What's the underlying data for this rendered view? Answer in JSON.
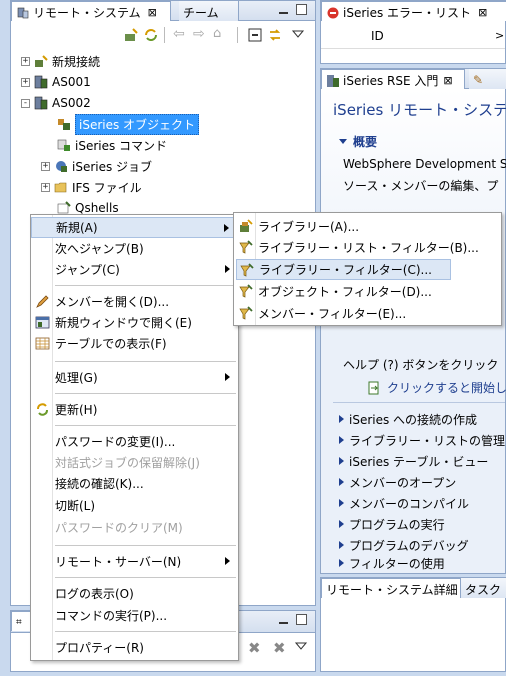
{
  "left_view": {
    "tab_title": "リモート・システム",
    "tab2_title": "チーム"
  },
  "tree": [
    {
      "label": "新規接続",
      "level": 1,
      "expander": "+"
    },
    {
      "label": "AS001",
      "level": 1,
      "expander": "+"
    },
    {
      "label": "AS002",
      "level": 1,
      "expander": "-"
    },
    {
      "label": "iSeries オブジェクト",
      "level": 2,
      "expander": "",
      "selected": true
    },
    {
      "label": "iSeries コマンド",
      "level": 2,
      "expander": ""
    },
    {
      "label": "iSeries ジョブ",
      "level": 2,
      "expander": "+"
    },
    {
      "label": "IFS ファイル",
      "level": 2,
      "expander": "+"
    },
    {
      "label": "Qshells",
      "level": 2,
      "expander": ""
    }
  ],
  "context_menu": {
    "items": [
      {
        "label": "新規(A)",
        "submenu": true,
        "highlighted": true
      },
      {
        "label": "次へジャンプ(B)"
      },
      {
        "label": "ジャンプ(C)",
        "submenu": true
      },
      {
        "label": "メンバーを開く(D)...",
        "icon": "pencil-icon"
      },
      {
        "label": "新規ウィンドウで開く(E)",
        "icon": "window-icon"
      },
      {
        "label": "テーブルでの表示(F)",
        "icon": "table-icon"
      },
      {
        "label": "処理(G)",
        "submenu": true
      },
      {
        "label": "更新(H)",
        "icon": "refresh-icon"
      },
      {
        "label": "パスワードの変更(I)..."
      },
      {
        "label": "対話式ジョブの保留解除(J)",
        "disabled": true
      },
      {
        "label": "接続の確認(K)..."
      },
      {
        "label": "切断(L)"
      },
      {
        "label": "パスワードのクリア(M)",
        "disabled": true
      },
      {
        "label": "リモート・サーバー(N)",
        "submenu": true
      },
      {
        "label": "ログの表示(O)"
      },
      {
        "label": "コマンドの実行(P)..."
      },
      {
        "label": "プロパティー(R)"
      }
    ]
  },
  "submenu": {
    "items": [
      {
        "label": "ライブラリー(A)..."
      },
      {
        "label": "ライブラリー・リスト・フィルター(B)..."
      },
      {
        "label": "ライブラリー・フィルター(C)...",
        "highlighted": true
      },
      {
        "label": "オブジェクト・フィルター(D)..."
      },
      {
        "label": "メンバー・フィルター(E)..."
      }
    ]
  },
  "error_view": {
    "tab_title": "iSeries エラー・リスト",
    "column_id": "ID"
  },
  "rse_view": {
    "tab_title": "iSeries RSE 入門",
    "heading": "iSeries リモート・システム",
    "section_title": "概要",
    "intro_line1": "WebSphere Development S",
    "intro_line2": "ソース・メンバーの編集、プ",
    "help_line": "ヘルプ (?) ボタンをクリック",
    "click_start": "クリックすると開始し",
    "links": [
      "iSeries への接続の作成",
      "ライブラリー・リストの管理",
      "iSeries テーブル・ビュー",
      "メンバーのオープン",
      "メンバーのコンパイル",
      "プログラムの実行",
      "プログラムのデバッグ",
      "フィルターの使用"
    ]
  },
  "bottom_right_tabs": {
    "tab1": "リモート・システム詳細",
    "tab2": "タスク"
  },
  "colors": {
    "selection": "#3399ff",
    "menu_highlight": "#dce7f5",
    "frame": "#8fa6c8",
    "link_blue": "#1f3f8f"
  }
}
